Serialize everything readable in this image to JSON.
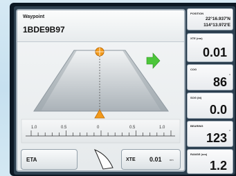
{
  "waypoint": {
    "label": "Waypoint",
    "id": "1BDE9B97"
  },
  "scale": {
    "ticks": [
      "1.0",
      "0.5",
      "0",
      "0.5",
      "1.0"
    ],
    "cross_track_fraction": 0.0
  },
  "buttons": {
    "eta_label": "ETA",
    "xte_label": "XTE",
    "xte_value": "0.01",
    "xte_unit": "nm"
  },
  "side_panels": {
    "position": {
      "label": "POSITION",
      "lat": "22°16.937'N",
      "lon": "114°13.972'E"
    },
    "xte": {
      "label": "XTE (nm)",
      "value": "0.01"
    },
    "cog": {
      "label": "COG",
      "value": "86",
      "unit": "°"
    },
    "sog": {
      "label": "SOG (kt)",
      "value": "0.0"
    },
    "bearing": {
      "label": "BEARING",
      "value": "123",
      "unit": "°"
    },
    "range": {
      "label": "RANGE (nm)",
      "value": "1.2"
    }
  },
  "colors": {
    "marker": "#f29a1c",
    "steer_arrow": "#4cc63a",
    "road": "#b7bec4"
  },
  "icons": {
    "steer": "arrow-right-icon",
    "waypoint_marker": "circle-cross-icon",
    "boat_marker": "triangle-icon",
    "vessel": "boat-outline-icon"
  }
}
